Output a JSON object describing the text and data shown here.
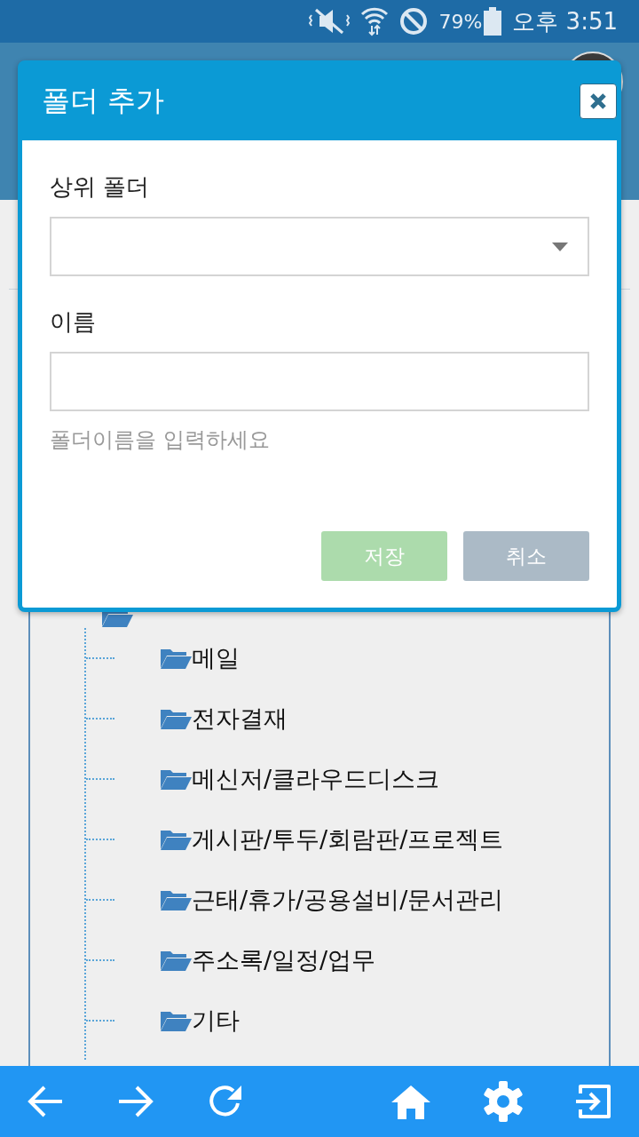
{
  "status_bar": {
    "battery": "79%",
    "time": "오후 3:51"
  },
  "dialog": {
    "title": "폴더 추가",
    "fields": [
      {
        "kind": "select",
        "label": "상위 폴더"
      },
      {
        "kind": "text",
        "label": "이름",
        "help_text": "폴더이름을 입력하세요"
      }
    ],
    "buttons": [
      {
        "label": "저장",
        "kind": "save",
        "disabled": true
      },
      {
        "label": "취소",
        "kind": "cancel",
        "disabled": false
      }
    ]
  },
  "folder_tree": {
    "children": [
      {
        "name": "메일"
      },
      {
        "name": "전자결재"
      },
      {
        "name": "메신저/클라우드디스크"
      },
      {
        "name": "게시판/투두/회람판/프로젝트"
      },
      {
        "name": "근태/휴가/공용설비/문서관리"
      },
      {
        "name": "주소록/일정/업무"
      },
      {
        "name": "기타"
      }
    ]
  }
}
